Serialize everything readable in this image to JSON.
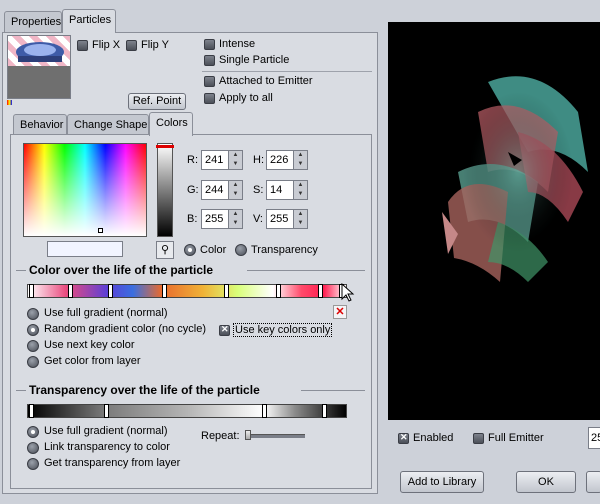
{
  "tabs_top": [
    {
      "label": "Properties"
    },
    {
      "label": "Particles"
    }
  ],
  "particles": {
    "flip_x": "Flip X",
    "flip_y": "Flip Y",
    "intense": "Intense",
    "single_particle": "Single Particle",
    "attached": "Attached to Emitter",
    "apply_all": "Apply to all",
    "ref_point": "Ref. Point"
  },
  "sub_tabs": [
    {
      "label": "Behavior"
    },
    {
      "label": "Change Shape"
    },
    {
      "label": "Colors"
    }
  ],
  "colors": {
    "r_label": "R:",
    "r": "241",
    "g_label": "G:",
    "g": "244",
    "b_label": "B:",
    "b": "255",
    "h_label": "H:",
    "h": "226",
    "s_label": "S:",
    "s": "14",
    "v_label": "V:",
    "v": "255",
    "mode_color": "Color",
    "mode_transparency": "Transparency",
    "current_color": "#f1f4ff"
  },
  "color_life": {
    "title": "Color over the life of the particle",
    "options": [
      {
        "label": "Use full gradient (normal)",
        "selected": false
      },
      {
        "label": "Random gradient color (no cycle)",
        "selected": true
      },
      {
        "label": "Use next key color",
        "selected": false
      },
      {
        "label": "Get color from layer",
        "selected": false
      }
    ],
    "key_only": "Use key colors only"
  },
  "transparency_life": {
    "title": "Transparency over the life of the particle",
    "options": [
      {
        "label": "Use full gradient (normal)",
        "selected": true
      },
      {
        "label": "Link transparency to color",
        "selected": false
      },
      {
        "label": "Get transparency from layer",
        "selected": false
      }
    ],
    "repeat": "Repeat:"
  },
  "preview": {
    "enabled": "Enabled",
    "full_emitter": "Full Emitter",
    "number": "25"
  },
  "footer": {
    "add_library": "Add to Library",
    "ok": "OK"
  },
  "accent": "#000000"
}
